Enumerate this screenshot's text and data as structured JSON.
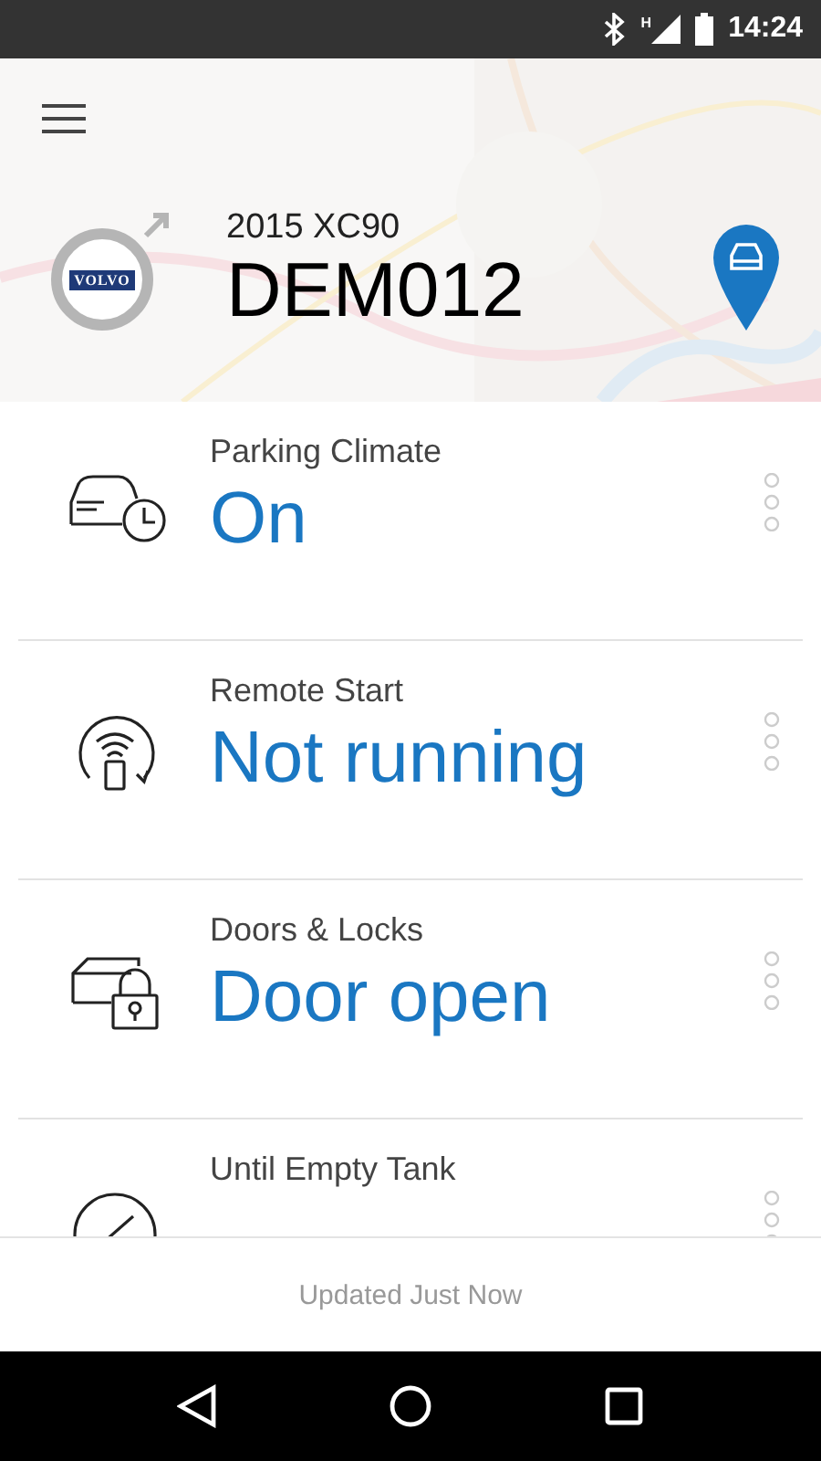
{
  "status_bar": {
    "time": "14:24",
    "network": "H"
  },
  "vehicle": {
    "logo_text": "VOLVO",
    "model": "2015 XC90",
    "plate": "DEM012"
  },
  "cards": [
    {
      "kind": "climate",
      "label": "Parking Climate",
      "value": "On"
    },
    {
      "kind": "remote",
      "label": "Remote Start",
      "value": "Not running"
    },
    {
      "kind": "doors",
      "label": "Doors & Locks",
      "value": "Door open"
    },
    {
      "kind": "fuel",
      "label": "Until Empty Tank"
    }
  ],
  "footer": {
    "text": "Updated Just Now"
  }
}
